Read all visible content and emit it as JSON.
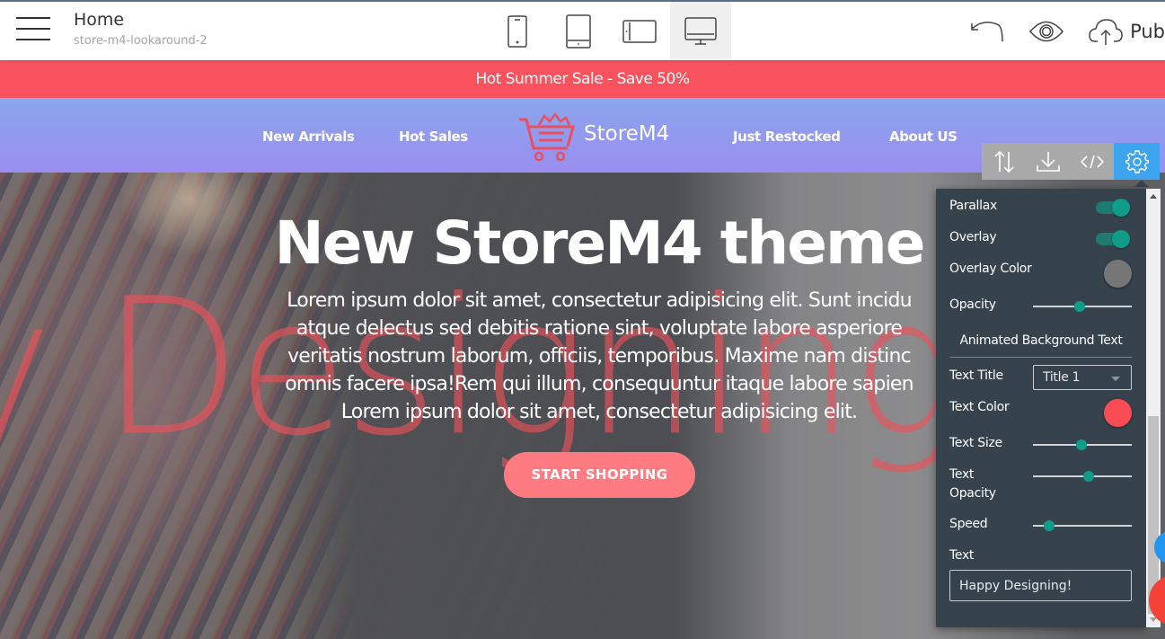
{
  "editor": {
    "page_title": "Home",
    "page_subtitle": "store-m4-lookaround-2",
    "devices": [
      {
        "name": "mobile",
        "icon": "phone-icon",
        "active": false
      },
      {
        "name": "tablet",
        "icon": "tablet-icon",
        "active": false
      },
      {
        "name": "tablet-landscape",
        "icon": "tablet-landscape-icon",
        "active": false
      },
      {
        "name": "desktop",
        "icon": "desktop-icon",
        "active": true
      }
    ],
    "actions": {
      "undo_icon": "undo-icon",
      "preview_icon": "eye-icon",
      "publish_icon": "cloud-upload-icon",
      "publish_label": "Pub"
    }
  },
  "site": {
    "sale_banner": "Hot Summer Sale - Save 50%",
    "nav": {
      "links_left": [
        "New Arrivals",
        "Hot Sales"
      ],
      "brand": "StoreM4",
      "links_right": [
        "Just Restocked",
        "About US"
      ]
    },
    "hero": {
      "background_text": "y Designing!",
      "title": "New StoreM4 theme",
      "body_lines": [
        "Lorem ipsum dolor sit amet, consectetur adipisicing elit. Sunt incidu",
        "atque delectus sed debitis ratione sint, voluptate labore asperiore",
        "veritatis nostrum laborum, officiis, temporibus. Maxime nam distinc",
        "omnis facere ipsa!Rem qui illum, consequuntur itaque labore sapien",
        "Lorem ipsum dolor sit amet, consectetur adipisicing elit."
      ],
      "cta_label": "START SHOPPING"
    }
  },
  "block_toolbar": {
    "tools": [
      {
        "name": "reorder",
        "icon": "arrows-up-down-icon"
      },
      {
        "name": "save-block",
        "icon": "download-icon"
      },
      {
        "name": "code",
        "icon": "code-icon"
      },
      {
        "name": "settings",
        "icon": "gear-icon",
        "active": true
      }
    ]
  },
  "settings_panel": {
    "parallax": {
      "label": "Parallax",
      "on": true
    },
    "overlay": {
      "label": "Overlay",
      "on": true
    },
    "overlay_color": {
      "label": "Overlay Color",
      "color": "#767676"
    },
    "opacity": {
      "label": "Opacity",
      "value": 0.47
    },
    "section_title": "Animated Background Text",
    "text_title": {
      "label": "Text Title",
      "value": "Title 1"
    },
    "text_color": {
      "label": "Text Color",
      "color": "#fa4c55"
    },
    "text_size": {
      "label": "Text Size",
      "value": 0.49
    },
    "text_opacity": {
      "label_line1": "Text",
      "label_line2": "Opacity",
      "value": 0.56
    },
    "speed": {
      "label": "Speed",
      "value": 0.16
    },
    "text": {
      "label": "Text",
      "value": "Happy Designing!"
    }
  },
  "colors": {
    "sale_red": "#f7525d",
    "cta": "#ff7b82",
    "accent_blue": "#3fa4f0",
    "panel_bg": "#36434d",
    "toggle_teal": "#0f9d8a"
  }
}
